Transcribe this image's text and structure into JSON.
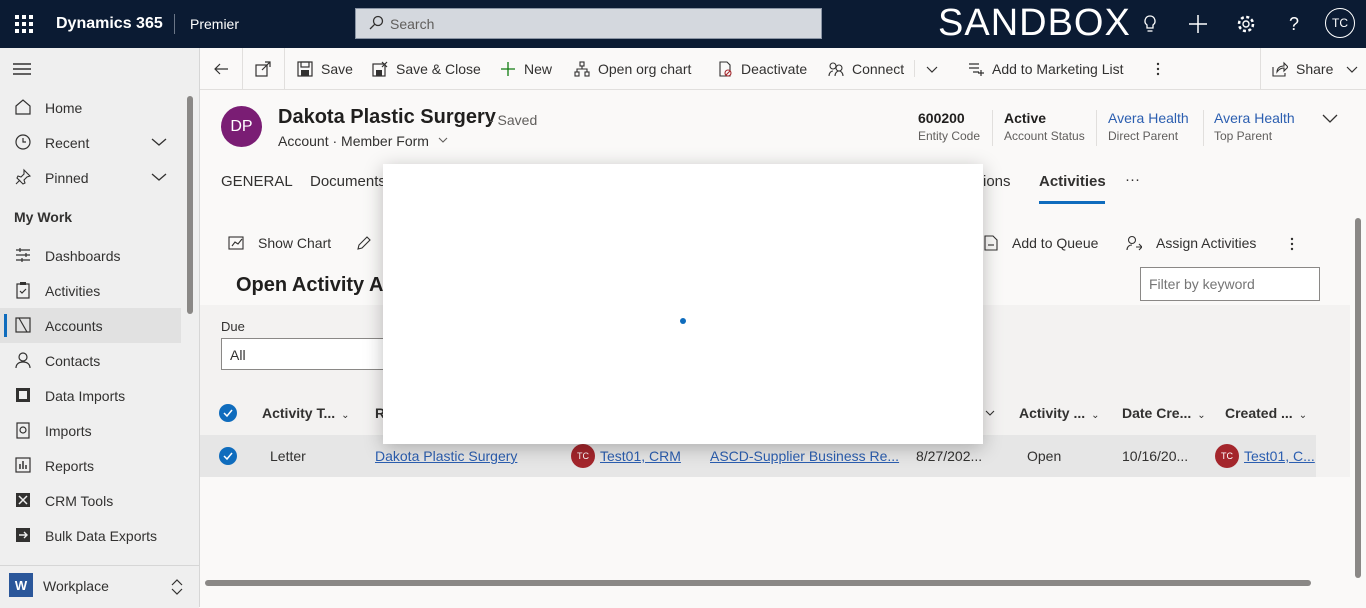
{
  "topbar": {
    "app_name": "Dynamics 365",
    "area": "Premier",
    "search_placeholder": "Search",
    "environment": "SANDBOX",
    "user_initials": "TC"
  },
  "sidebar": {
    "items": [
      {
        "label": "Home",
        "icon": "home-icon"
      },
      {
        "label": "Recent",
        "icon": "clock-icon"
      },
      {
        "label": "Pinned",
        "icon": "pin-icon"
      }
    ],
    "section_title": "My Work",
    "work_items": [
      {
        "label": "Dashboards",
        "icon": "dashboard-icon"
      },
      {
        "label": "Activities",
        "icon": "clipboard-icon"
      },
      {
        "label": "Accounts",
        "icon": "building-icon",
        "selected": true
      },
      {
        "label": "Contacts",
        "icon": "person-icon"
      },
      {
        "label": "Data Imports",
        "icon": "import-icon"
      },
      {
        "label": "Imports",
        "icon": "document-icon"
      },
      {
        "label": "Reports",
        "icon": "report-icon"
      },
      {
        "label": "CRM Tools",
        "icon": "tools-icon"
      },
      {
        "label": "Bulk Data Exports",
        "icon": "export-icon"
      }
    ],
    "area_switcher_badge": "W",
    "area_switcher": "Workplace"
  },
  "commands": {
    "save": "Save",
    "save_close": "Save & Close",
    "new": "New",
    "org_chart": "Open org chart",
    "deactivate": "Deactivate",
    "connect": "Connect",
    "marketing": "Add to Marketing List",
    "share": "Share"
  },
  "record": {
    "initials": "DP",
    "title": "Dakota Plastic Surgery",
    "status_suffix": "- Saved",
    "subtitle": "Account · Member Form",
    "fields": [
      {
        "value": "600200",
        "label": "Entity Code"
      },
      {
        "value": "Active",
        "label": "Account Status"
      },
      {
        "value": "Avera Health",
        "label": "Direct Parent"
      },
      {
        "value": "Avera Health",
        "label": "Top Parent"
      }
    ]
  },
  "tabs": {
    "general": "GENERAL",
    "documents": "Documents",
    "relations_fragment": "ions",
    "activities": "Activities",
    "more": "···"
  },
  "subgrid": {
    "show_chart": "Show Chart",
    "add_queue": "Add to Queue",
    "assign": "Assign Activities",
    "view_title": "Open Activity A",
    "filter_placeholder": "Filter by keyword",
    "due_label": "Due",
    "due_value": "All",
    "columns": [
      "Activity T...",
      "R",
      "Activity ...",
      "Date Cre...",
      "Created ..."
    ],
    "row": {
      "type": "Letter",
      "regarding": "Dakota Plastic Surgery",
      "owner_initials": "TC",
      "owner": "Test01, CRM",
      "subject": "ASCD-Supplier Business Re...",
      "due": "8/27/202...",
      "status": "Open",
      "created": "10/16/20...",
      "created_by_initials": "TC",
      "created_by": "Test01, C..."
    }
  },
  "colors": {
    "topbar": "#0b1b33",
    "accent": "#0f6cbd",
    "avatar": "#7a1d74",
    "user_avatar": "#a4262c"
  }
}
